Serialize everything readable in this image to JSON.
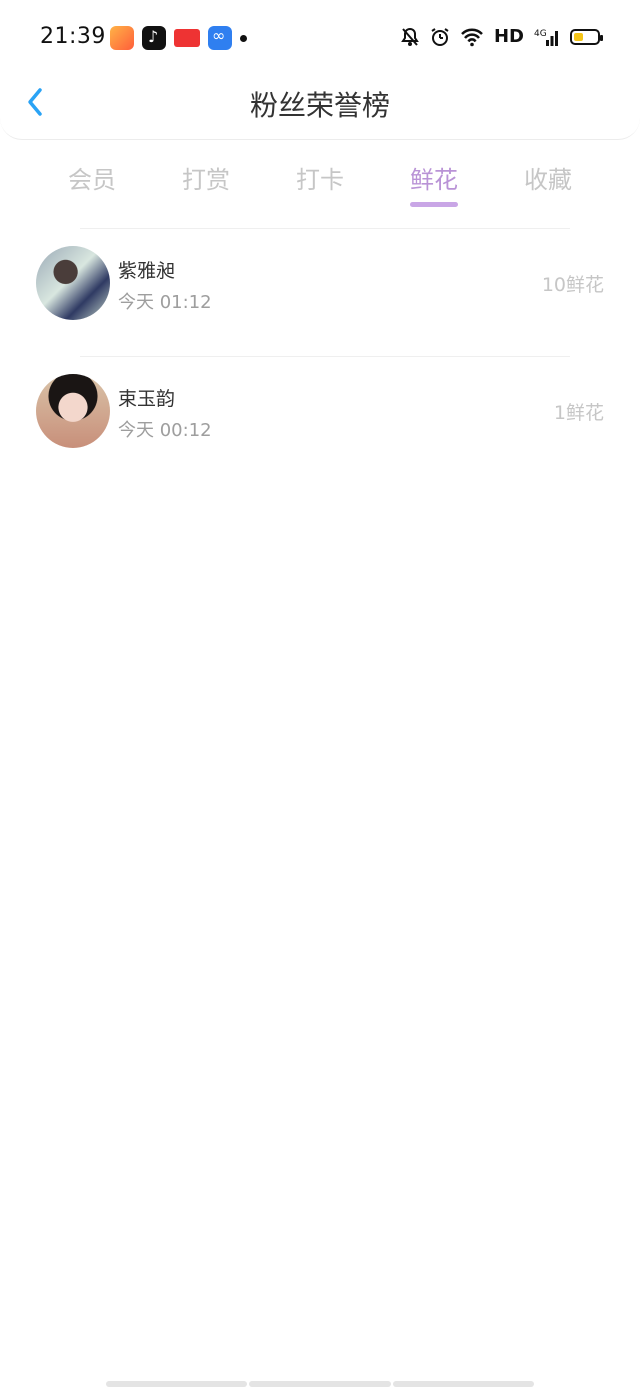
{
  "status_bar": {
    "time": "21:39",
    "app_icons": [
      "xiaomi-red-icon",
      "tiktok-icon",
      "toutiao-icon",
      "infinity-app-icon"
    ],
    "network": "HD",
    "signal": "4G"
  },
  "header": {
    "title": "粉丝荣誉榜",
    "back_icon": "chevron-left-icon",
    "accent": "#2aa3f5"
  },
  "tabs": [
    {
      "label": "会员"
    },
    {
      "label": "打赏"
    },
    {
      "label": "打卡"
    },
    {
      "label": "鲜花"
    },
    {
      "label": "收藏"
    }
  ],
  "active_tab": "鲜花",
  "active_color": "#b993d6",
  "list": [
    {
      "name": "紫雅昶",
      "time": "今天 01:12",
      "count": "10鲜花"
    },
    {
      "name": "束玉韵",
      "time": "今天 00:12",
      "count": "1鲜花"
    }
  ]
}
